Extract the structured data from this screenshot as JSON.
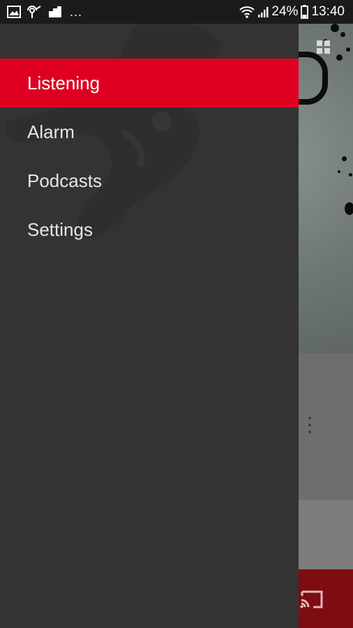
{
  "status_bar": {
    "dots": "...",
    "battery": "24%",
    "time": "13:40"
  },
  "drawer": {
    "items": [
      {
        "label": "Listening",
        "active": true
      },
      {
        "label": "Alarm",
        "active": false
      },
      {
        "label": "Podcasts",
        "active": false
      },
      {
        "label": "Settings",
        "active": false
      }
    ]
  },
  "colors": {
    "accent": "#df0021",
    "drawer_bg": "#333333",
    "status_bar_bg": "#1b1b1b",
    "bottom_bar": "#7d0d12"
  },
  "icons": {
    "status_left": [
      "gallery-icon",
      "radio-icon",
      "notification-icon"
    ],
    "status_right": [
      "wifi-icon",
      "signal-icon",
      "battery-icon"
    ],
    "background": [
      "grid-icon",
      "more-vert-icon",
      "cast-icon"
    ]
  }
}
